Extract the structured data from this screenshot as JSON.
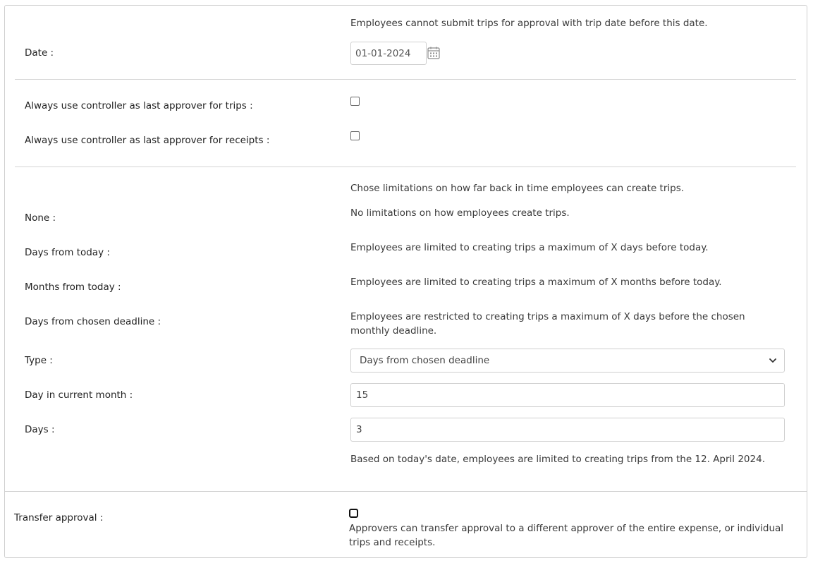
{
  "date_section": {
    "description": "Employees cannot submit trips for approval with trip date before this date.",
    "label": "Date :",
    "value": "01-01-2024",
    "calendar_icon": "calendar-icon"
  },
  "controller_section": {
    "trips_label": "Always use controller as last approver for trips :",
    "trips_checked": false,
    "receipts_label": "Always use controller as last approver for receipts :",
    "receipts_checked": false
  },
  "limitations_section": {
    "intro": "Chose limitations on how far back in time employees can create trips.",
    "options": [
      {
        "label": "None :",
        "description": "No limitations on how employees create trips."
      },
      {
        "label": "Days from today :",
        "description": "Employees are limited to creating trips a maximum of X days before today."
      },
      {
        "label": "Months from today :",
        "description": "Employees are limited to creating trips a maximum of X months before today."
      },
      {
        "label": "Days from chosen deadline :",
        "description": "Employees are restricted to creating trips a maximum of X days before the chosen monthly deadline."
      }
    ],
    "type_label": "Type :",
    "type_value": "Days from chosen deadline",
    "day_in_month_label": "Day in current month :",
    "day_in_month_value": "15",
    "days_label": "Days :",
    "days_value": "3",
    "summary": "Based on today's date, employees are limited to creating trips from the 12. April 2024."
  },
  "transfer_section": {
    "label": "Transfer approval :",
    "checked": false,
    "description": "Approvers can transfer approval to a different approver of the entire expense, or individual trips and receipts."
  }
}
